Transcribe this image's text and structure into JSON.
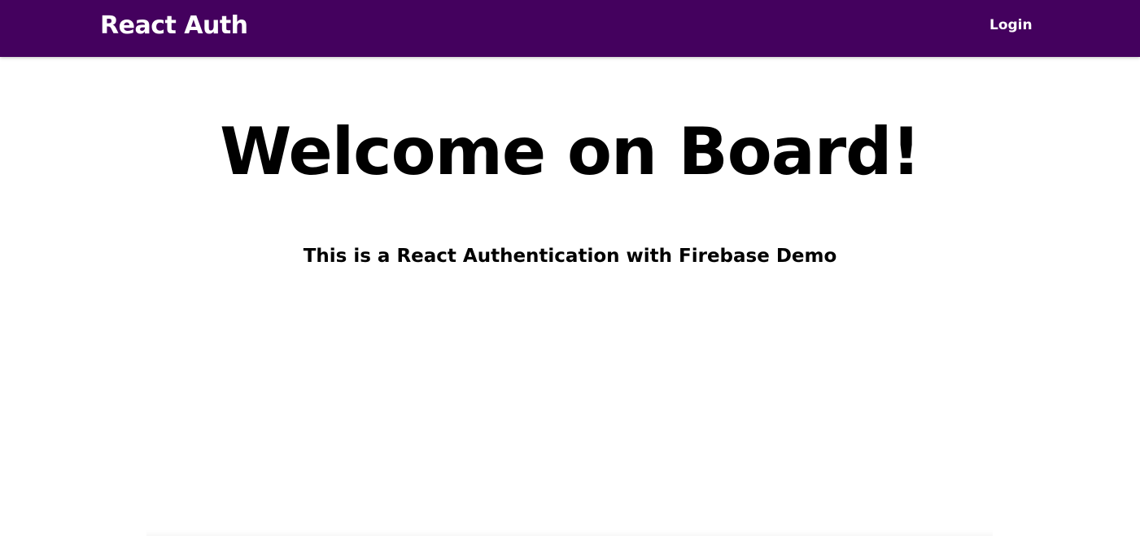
{
  "header": {
    "logo_text": "React Auth",
    "nav": {
      "login_label": "Login"
    }
  },
  "main": {
    "title": "Welcome on Board!",
    "subtitle": "This is a React Authentication with Firebase Demo"
  },
  "colors": {
    "header_background": "#44015e",
    "header_text": "#ffffff",
    "page_background": "#ffffff",
    "body_text": "#000000"
  }
}
